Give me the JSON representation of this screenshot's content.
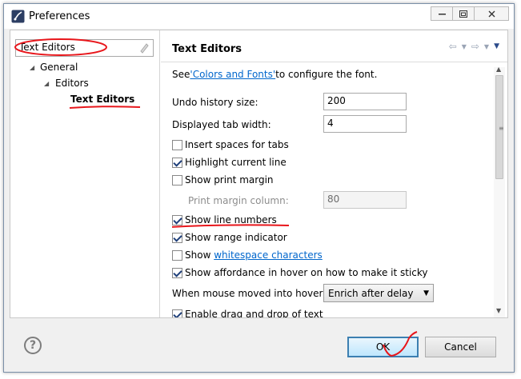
{
  "window": {
    "title": "Preferences"
  },
  "sidebar": {
    "filter_value": "Text Editors",
    "tree": [
      {
        "label": "General",
        "level": 1
      },
      {
        "label": "Editors",
        "level": 2
      },
      {
        "label": "Text Editors",
        "level": 3,
        "selected": true
      }
    ]
  },
  "page": {
    "title": "Text Editors",
    "font_note_prefix": "See ",
    "font_note_link": "'Colors and Fonts'",
    "font_note_suffix": " to configure the font.",
    "undo_label": "Undo history size:",
    "undo_value": "200",
    "tab_width_label": "Displayed tab width:",
    "tab_width_value": "4",
    "insert_spaces_label": "Insert spaces for tabs",
    "highlight_line_label": "Highlight current line",
    "print_margin_label": "Show print margin",
    "print_margin_column_label": "Print margin column:",
    "print_margin_column_value": "80",
    "line_numbers_label": "Show line numbers",
    "range_indicator_label": "Show range indicator",
    "whitespace_prefix": "Show ",
    "whitespace_link": "whitespace characters",
    "affordance_label": "Show affordance in hover on how to make it sticky",
    "hover_label": "When mouse moved into hover:",
    "hover_value": "Enrich after delay",
    "drag_drop_label": "Enable drag and drop of text"
  },
  "footer": {
    "ok_label": "OK",
    "cancel_label": "Cancel",
    "help_glyph": "?"
  },
  "colors": {
    "annotation_red": "#e8161b",
    "link": "#0066cc",
    "ok_border": "#3c7fb1"
  }
}
